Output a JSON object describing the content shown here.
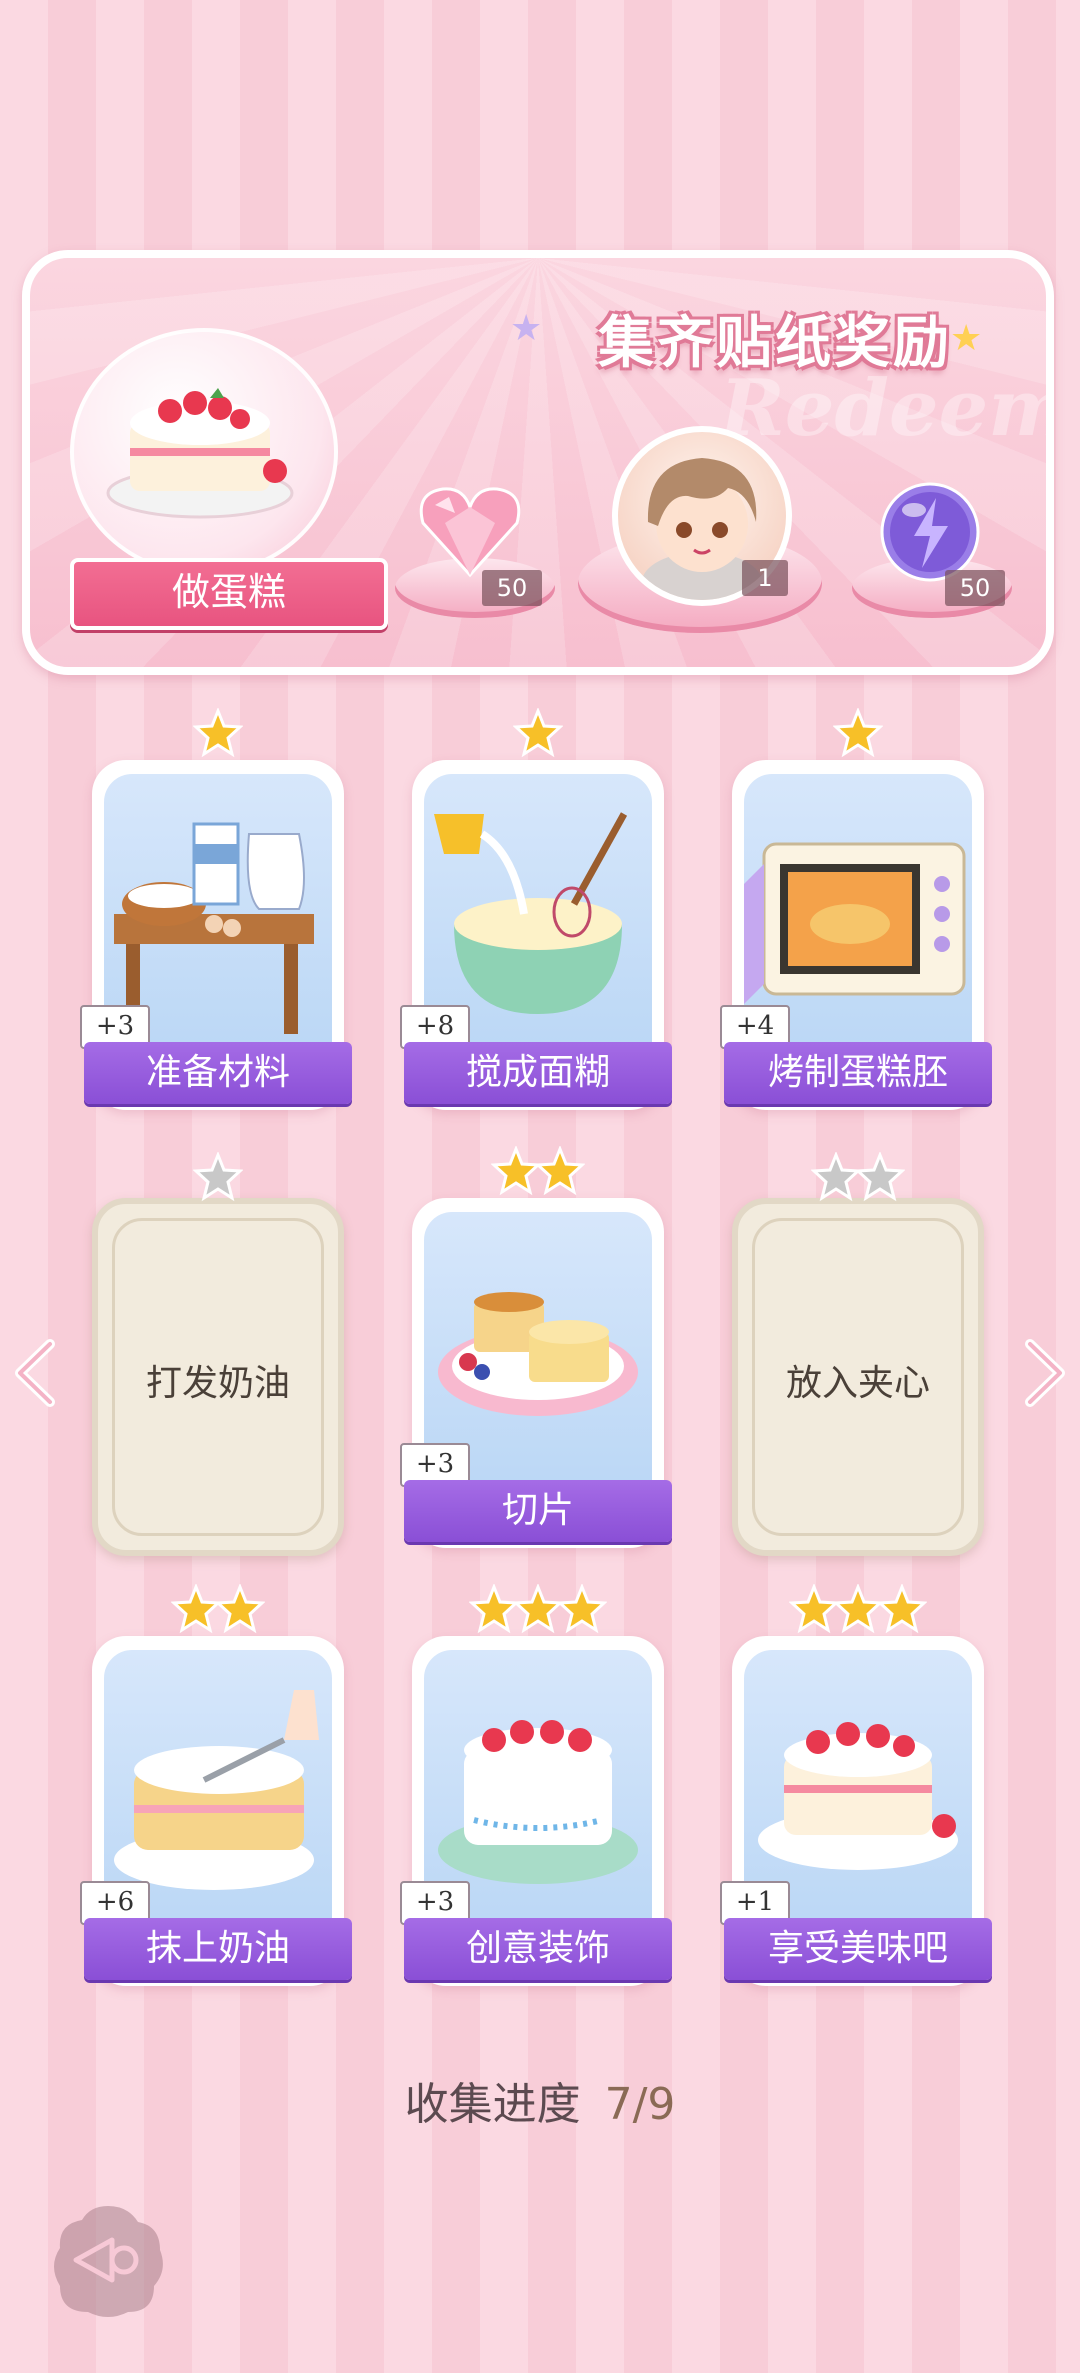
{
  "banner": {
    "title": "集齐贴纸奖励",
    "watermark": "Redeem",
    "main_label": "做蛋糕",
    "rewards": [
      {
        "icon": "heart-gem-icon",
        "count": "50"
      },
      {
        "icon": "avatar-sticker-icon",
        "count": "1"
      },
      {
        "icon": "energy-orb-icon",
        "count": "50"
      }
    ]
  },
  "cards": [
    {
      "label": "准备材料",
      "badge": "+3",
      "stars": 1,
      "star_max": 1,
      "unlocked": true
    },
    {
      "label": "搅成面糊",
      "badge": "+8",
      "stars": 1,
      "star_max": 1,
      "unlocked": true
    },
    {
      "label": "烤制蛋糕胚",
      "badge": "+4",
      "stars": 1,
      "star_max": 1,
      "unlocked": true
    },
    {
      "label": "打发奶油",
      "badge": "",
      "stars": 0,
      "star_max": 1,
      "unlocked": false
    },
    {
      "label": "切片",
      "badge": "+3",
      "stars": 2,
      "star_max": 2,
      "unlocked": true
    },
    {
      "label": "放入夹心",
      "badge": "",
      "stars": 0,
      "star_max": 2,
      "unlocked": false
    },
    {
      "label": "抹上奶油",
      "badge": "+6",
      "stars": 2,
      "star_max": 2,
      "unlocked": true
    },
    {
      "label": "创意装饰",
      "badge": "+3",
      "stars": 3,
      "star_max": 3,
      "unlocked": true
    },
    {
      "label": "享受美味吧",
      "badge": "+1",
      "stars": 3,
      "star_max": 3,
      "unlocked": true
    }
  ],
  "progress": {
    "label": "收集进度",
    "value": "7/9"
  },
  "colors": {
    "ribbon": "#8a4fd6",
    "banner_label": "#ee5f88",
    "star_gold": "#f7c028",
    "star_gray": "#c8c8c8"
  }
}
